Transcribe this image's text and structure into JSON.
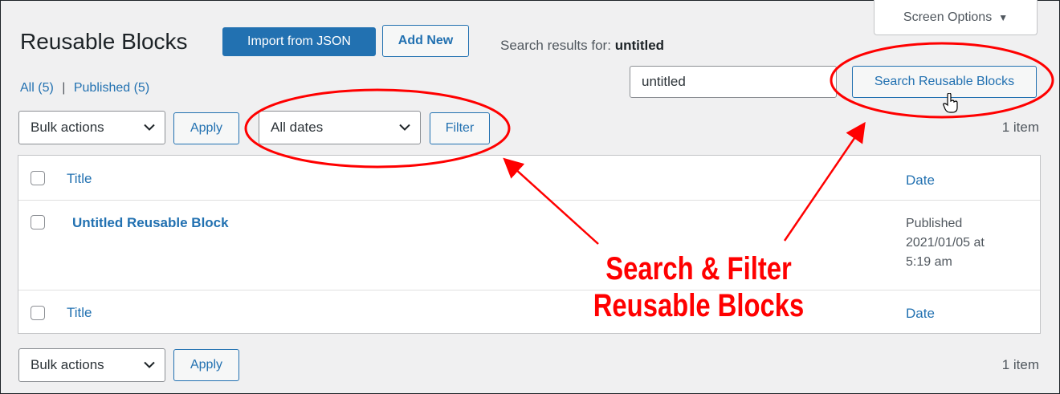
{
  "header": {
    "title": "Reusable Blocks",
    "import_label": "Import from JSON",
    "add_new_label": "Add New",
    "search_results_prefix": "Search results for:",
    "search_term": "untitled",
    "screen_options_label": "Screen Options"
  },
  "subsubsub": {
    "all_label": "All",
    "all_count": "(5)",
    "separator": "|",
    "published_label": "Published",
    "published_count": "(5)"
  },
  "search": {
    "value": "untitled",
    "button_label": "Search Reusable Blocks"
  },
  "tablenav_top": {
    "bulk_actions": "Bulk actions",
    "apply_label": "Apply",
    "dates": "All dates",
    "filter_label": "Filter",
    "items_count": "1 item"
  },
  "table": {
    "col_title": "Title",
    "col_date": "Date",
    "rows": [
      {
        "title": "Untitled Reusable Block",
        "date_status": "Published",
        "date_value": "2021/01/05 at",
        "date_time": "5:19 am"
      }
    ]
  },
  "tablenav_bottom": {
    "bulk_actions": "Bulk actions",
    "apply_label": "Apply",
    "items_count": "1 item"
  },
  "annotation": {
    "line1": "Search & Filter",
    "line2": "Reusable Blocks",
    "color": "#ff0000"
  },
  "colors": {
    "accent": "#2271b1",
    "background": "#f0f0f1"
  }
}
